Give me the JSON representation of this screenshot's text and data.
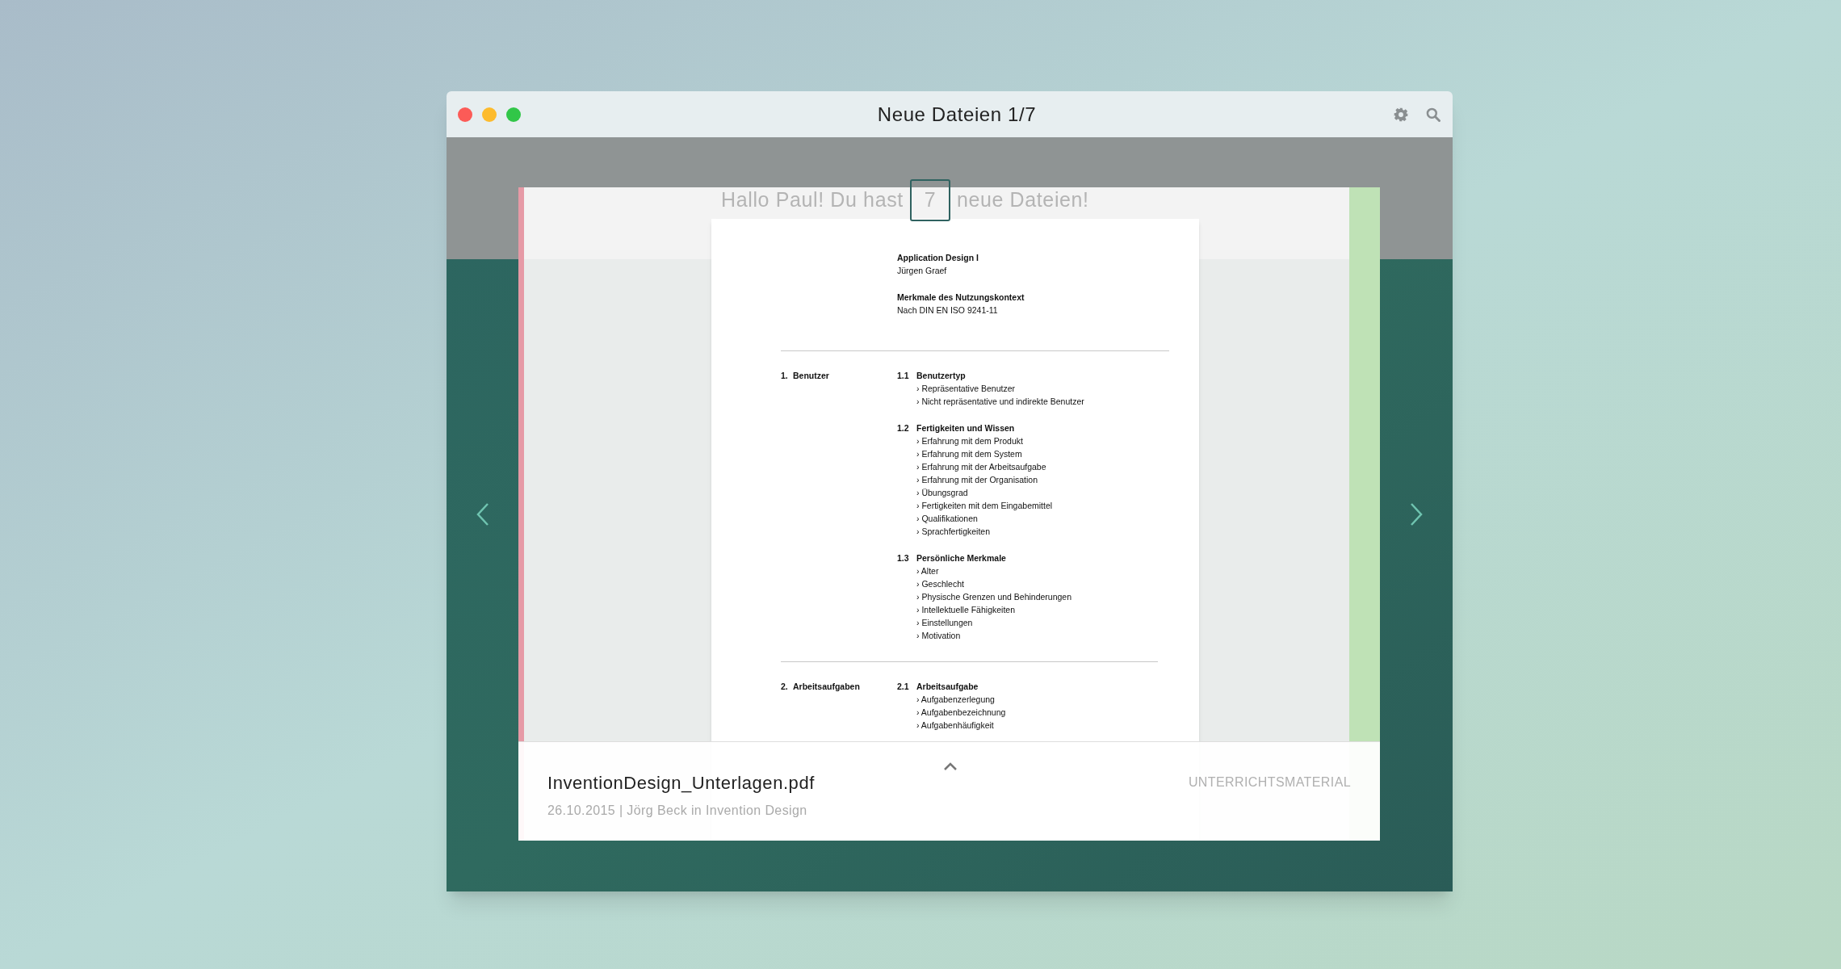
{
  "window": {
    "title": "Neue Dateien 1/7"
  },
  "greeting": {
    "prefix": "Hallo  Paul!  Du hast",
    "count": "7",
    "suffix": "neue Dateien!"
  },
  "document": {
    "title": "Application Design I",
    "author": "Jürgen Graef",
    "subtitle": "Merkmale des Nutzungskontext",
    "norm": "Nach DIN EN ISO 9241-11",
    "sections": [
      {
        "number": "1.",
        "label": "Benutzer",
        "subsections": [
          {
            "number": "1.1",
            "title": "Benutzertyp",
            "items": [
              "› Repräsentative Benutzer",
              "› Nicht repräsentative und indirekte Benutzer"
            ]
          },
          {
            "number": "1.2",
            "title": "Fertigkeiten und Wissen",
            "items": [
              "› Erfahrung mit dem Produkt",
              "› Erfahrung mit dem System",
              "› Erfahrung mit der Arbeitsaufgabe",
              "› Erfahrung mit der Organisation",
              "› Übungsgrad",
              "› Fertigkeiten mit dem Eingabemittel",
              "› Qualifikationen",
              "› Sprachfertigkeiten"
            ]
          },
          {
            "number": "1.3",
            "title": "Persönliche Merkmale",
            "items": [
              "› Alter",
              "› Geschlecht",
              "› Physische Grenzen und Behinderungen",
              "› Intellektuelle Fähigkeiten",
              "› Einstellungen",
              "› Motivation"
            ]
          }
        ]
      },
      {
        "number": "2.",
        "label": "Arbeitsaufgaben",
        "subsections": [
          {
            "number": "2.1",
            "title": "Arbeitsaufgabe",
            "items": [
              "› Aufgabenzerlegung",
              "› Aufgabenbezeichnung",
              "› Aufgabenhäufigkeit"
            ]
          }
        ]
      }
    ]
  },
  "footer": {
    "filename": "InventionDesign_Unterlagen.pdf",
    "meta": "26.10.2015 | Jörg Beck in Invention Design",
    "category": "UNTERRICHTSMATERIAL"
  }
}
